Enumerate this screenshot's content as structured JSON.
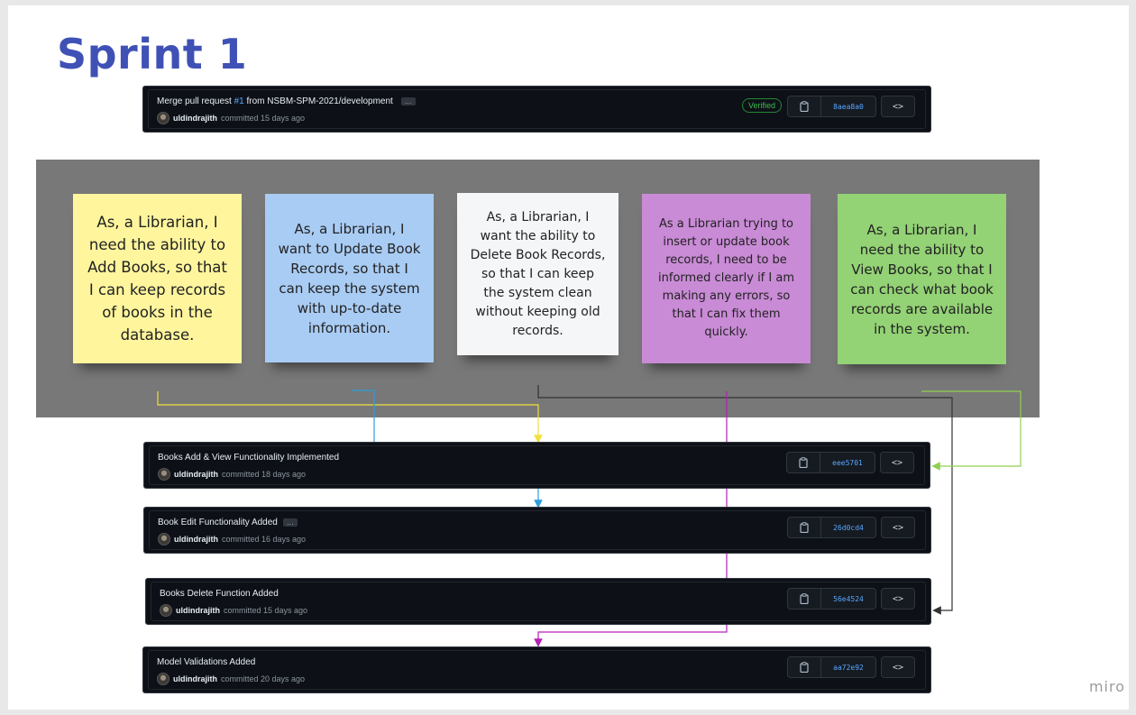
{
  "board": {
    "title": "Sprint 1",
    "watermark": "miro"
  },
  "top_commit": {
    "title_prefix": "Merge pull request ",
    "pr_number": "#1",
    "title_suffix": " from NSBM-SPM-2021/development",
    "ellipsis": "…",
    "author": "uldindrajith",
    "meta": "committed 15 days ago",
    "verified": "Verified",
    "sha": "8aea8a0",
    "copy_icon": "clipboard-icon",
    "browse_icon": "code-icon",
    "browse_label": "<>"
  },
  "notes": [
    {
      "text": "As, a Librarian, I need the ability to Add Books, so that I can keep records of books in the database.",
      "color": "#fff59d"
    },
    {
      "text": "As, a Librarian, I want to Update Book Records, so that I can keep the system with up-to-date information.",
      "color": "#a9ccf4"
    },
    {
      "text": "As, a Librarian, I want the ability to Delete Book Records, so that I can keep the system clean without keeping old records.",
      "color": "#f5f6f8"
    },
    {
      "text": "As a Librarian trying to insert or update book records, I need to be informed clearly if I am making any errors, so that I can fix them quickly.",
      "color": "#c98bd6"
    },
    {
      "text": "As, a Librarian, I need the ability to View Books, so that I can check what book records are available in the system.",
      "color": "#93d275"
    }
  ],
  "commits": [
    {
      "title": "Books Add & View Functionality Implemented",
      "has_ellipsis": false,
      "author": "uldindrajith",
      "meta": "committed 18 days ago",
      "sha": "eee5701"
    },
    {
      "title": "Book Edit Functionality Added",
      "has_ellipsis": true,
      "ellipsis": "…",
      "author": "uldindrajith",
      "meta": "committed 16 days ago",
      "sha": "26d0cd4"
    },
    {
      "title": "Books Delete Function Added",
      "has_ellipsis": false,
      "author": "uldindrajith",
      "meta": "committed 15 days ago",
      "sha": "56e4524"
    },
    {
      "title": "Model Validations Added",
      "has_ellipsis": false,
      "author": "uldindrajith",
      "meta": "committed 20 days ago",
      "sha": "aa72e92"
    }
  ],
  "connector_colors": {
    "add": "#f0e03a",
    "update": "#2d9cdb",
    "delete": "#333333",
    "validation": "#b620b8",
    "view": "#8fd14f"
  }
}
